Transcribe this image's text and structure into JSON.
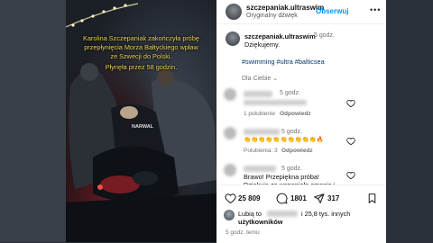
{
  "header": {
    "username": "szczepaniak.ultraswim",
    "audio": "Oryginalny dźwięk",
    "follow_label": "Obserwuj",
    "more": "•••"
  },
  "video": {
    "overlay_line1": "Karolina Szczepaniak zakończyła próbę",
    "overlay_line2": "przepłynięcia Morza Bałtyckiego wpław",
    "overlay_line3": "ze Szwecji do Polski.",
    "overlay_line4": "Płynęła przez 58 godzin.",
    "suit_text": "NARWAL"
  },
  "caption": {
    "username": "szczepaniak.ultraswim",
    "time": "5 godz.",
    "text": "Dziękujemy.",
    "hashtags": "#swimming #ultra #balticsea",
    "translate": "Dla Ciebie ⌄"
  },
  "comments": [
    {
      "time": "5 godz.",
      "likes": "1 polubienie",
      "reply": "Odpowiedz",
      "text": ""
    },
    {
      "time": "5 godz.",
      "likes": "Polubienia: 3",
      "reply": "Odpowiedz",
      "text": "👏👏👏👏👏👏👏👏👏👏🔥"
    },
    {
      "time": "5 godz.",
      "text1": "Brawo! Przepiękna próba!",
      "text2": "Dziękuję za wspaniałe emocje i"
    }
  ],
  "footer": {
    "likes_count": "25 809",
    "comments_count": "1801",
    "shares_count": "317",
    "liked_by_prefix": "Lubią to",
    "liked_by_suffix": "i 25,8 tys. innych",
    "liked_by_line2": "użytkowników",
    "time": "5 godz. temu"
  }
}
